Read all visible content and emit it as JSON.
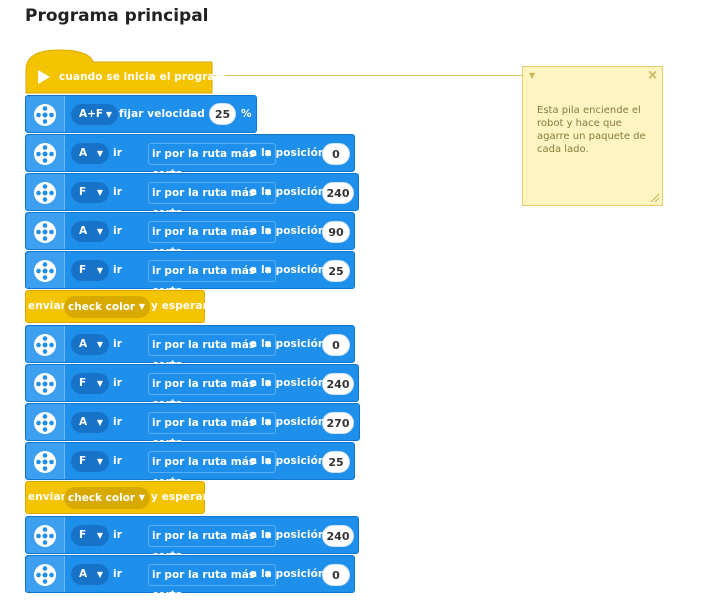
{
  "page": {
    "title": "Programa principal"
  },
  "start_block": {
    "label": "cuando se inicia el program"
  },
  "speed_block": {
    "port": "A+F",
    "label": "fijar velocidad a",
    "value": "25",
    "unit": "%"
  },
  "move_label_1": "ir por la ruta más corta",
  "move_label_2": "a la posición",
  "wait_block": {
    "label_pre": "enviar",
    "message": "check color",
    "label_post": "y esperar"
  },
  "moves_group1": [
    {
      "port": "A",
      "value": "0"
    },
    {
      "port": "F",
      "value": "240"
    },
    {
      "port": "A",
      "value": "90"
    },
    {
      "port": "F",
      "value": "25"
    }
  ],
  "moves_group2": [
    {
      "port": "A",
      "value": "0"
    },
    {
      "port": "F",
      "value": "240"
    },
    {
      "port": "A",
      "value": "270"
    },
    {
      "port": "F",
      "value": "25"
    }
  ],
  "moves_group3": [
    {
      "port": "F",
      "value": "240"
    },
    {
      "port": "A",
      "value": "0"
    }
  ],
  "note": {
    "text": "Esta pila enciende el robot y hace que agarre un paquete de cada lado.",
    "collapse_icon": "chevron-down-icon",
    "close_icon": "close-icon"
  },
  "colors": {
    "event_yellow": "#f5c400",
    "motor_blue": "#1e8fea",
    "note_bg": "#fdf4c2"
  }
}
